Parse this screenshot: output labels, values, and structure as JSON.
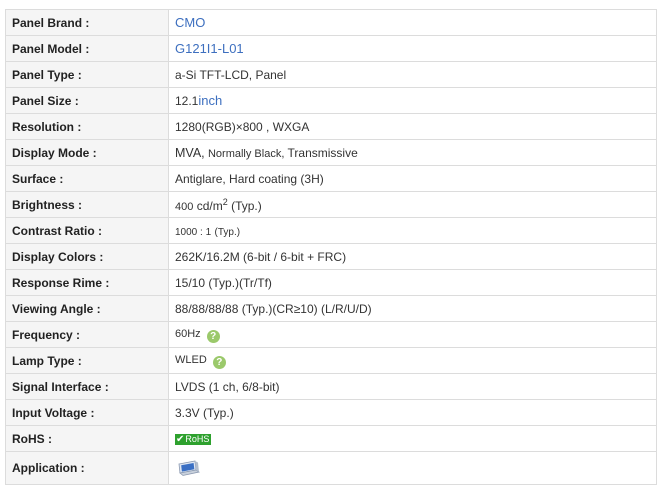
{
  "rows": [
    {
      "label": "Panel Brand :",
      "value": "CMO"
    },
    {
      "label": "Panel Model :",
      "value": "G121I1-L01"
    },
    {
      "label": "Panel Type :",
      "value": "a-Si TFT-LCD, Panel"
    },
    {
      "label": "Panel Size :",
      "value": "12.1",
      "unit": "inch"
    },
    {
      "label": "Resolution :",
      "value": "1280(RGB)×800 ,  WXGA"
    },
    {
      "label": "Display Mode :",
      "value_a": "MVA,",
      "value_b": "Normally Black,",
      "value_c": "Transmissive"
    },
    {
      "label": "Surface :",
      "value": "Antiglare, Hard coating (3H)"
    },
    {
      "label": "Brightness :",
      "value_a": "400",
      "value_b": "cd/m",
      "sup": "2",
      "value_c": "(Typ.)"
    },
    {
      "label": "Contrast Ratio :",
      "value_a": "1000 : 1",
      "value_b": "(Typ.)"
    },
    {
      "label": "Display Colors :",
      "value": "262K/16.2M   (6-bit / 6-bit + FRC)"
    },
    {
      "label": "Response Rime :",
      "value": "15/10 (Typ.)(Tr/Tf)"
    },
    {
      "label": "Viewing Angle :",
      "value": "88/88/88/88 (Typ.)(CR≥10) (L/R/U/D)"
    },
    {
      "label": "Frequency :",
      "value": "60Hz",
      "help": "?"
    },
    {
      "label": "Lamp Type :",
      "value": "WLED",
      "help": "?"
    },
    {
      "label": "Signal Interface :",
      "value": "LVDS (1 ch, 6/8-bit)"
    },
    {
      "label": "Input Voltage :",
      "value": "3.3V (Typ.)"
    },
    {
      "label": "RoHS :",
      "badge_check": "✔",
      "badge_text": "RoHS"
    },
    {
      "label": "Application :",
      "icon": "laptop-application-icon"
    }
  ],
  "colors": {
    "label_bg": "#f5f5f5",
    "border": "#dcdcdc",
    "link": "#3d6fbf",
    "help_icon": "#9bc96b",
    "rohs_badge": "#2ea12e"
  }
}
